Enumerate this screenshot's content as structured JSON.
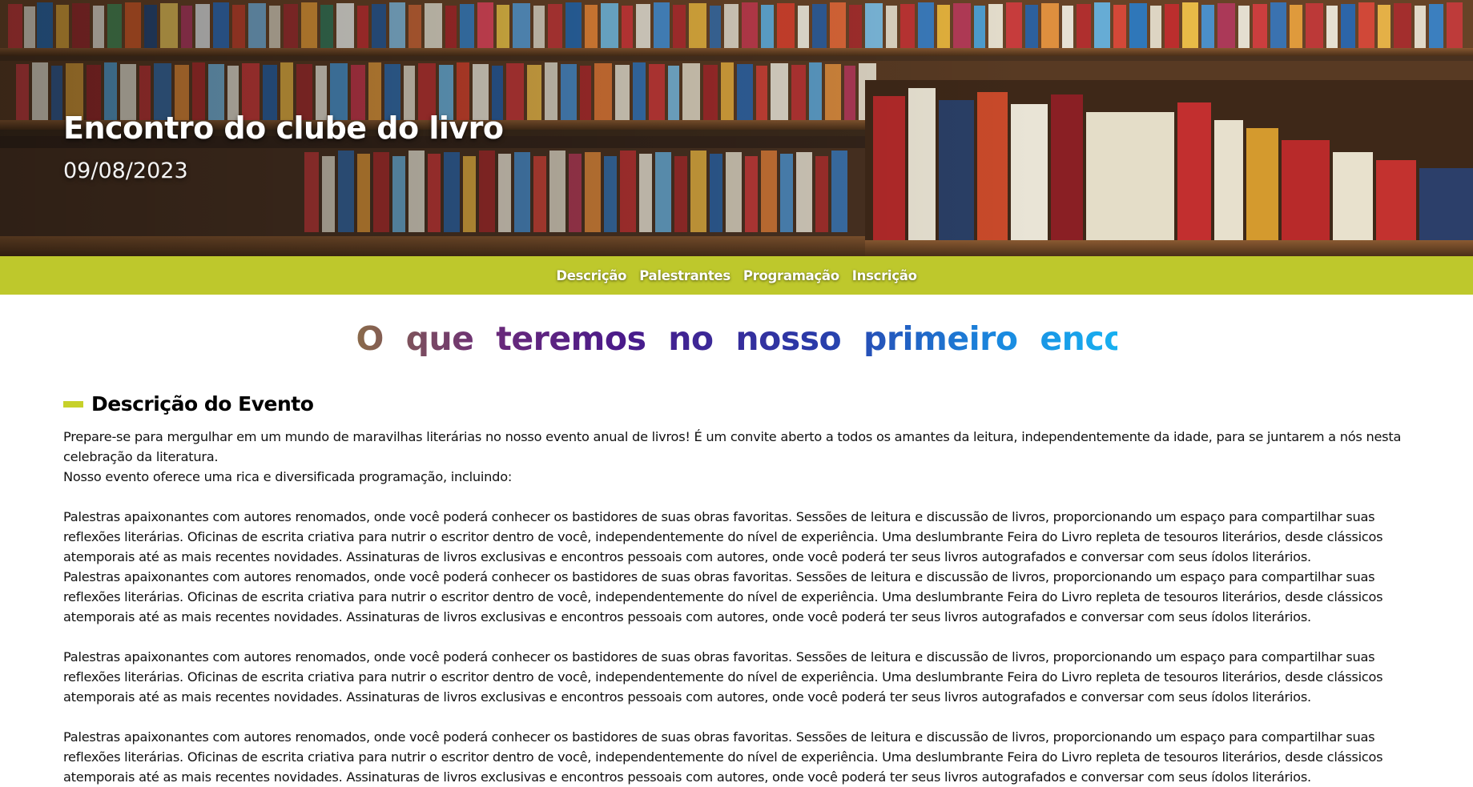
{
  "hero": {
    "title": "Encontro do clube do livro",
    "date": "09/08/2023"
  },
  "nav": {
    "items": [
      {
        "label": "Descrição"
      },
      {
        "label": "Palestrantes"
      },
      {
        "label": "Programação"
      },
      {
        "label": "Inscrição"
      }
    ]
  },
  "headline": "O que teremos no nosso primeiro encontro ?",
  "section": {
    "title": "Descrição do Evento",
    "intro_1": "Prepare-se para mergulhar em um mundo de maravilhas literárias no nosso evento anual de livros! É um convite aberto a todos os amantes da leitura, independentemente da idade, para se juntarem a nós nesta celebração da literatura.",
    "intro_2": "Nosso evento oferece uma rica e diversificada programação, incluindo:",
    "paragraph": "Palestras apaixonantes com autores renomados, onde você poderá conhecer os bastidores de suas obras favoritas. Sessões de leitura e discussão de livros, proporcionando um espaço para compartilhar suas reflexões literárias. Oficinas de escrita criativa para nutrir o escritor dentro de você, independentemente do nível de experiência. Uma deslumbrante Feira do Livro repleta de tesouros literários, desde clássicos atemporais até as mais recentes novidades. Assinaturas de livros exclusivas e encontros pessoais com autores, onde você poderá ter seus livros autografados e conversar com seus ídolos literários."
  },
  "colors": {
    "nav_bg": "#bec82c",
    "accent_bar": "#c7d12a"
  }
}
